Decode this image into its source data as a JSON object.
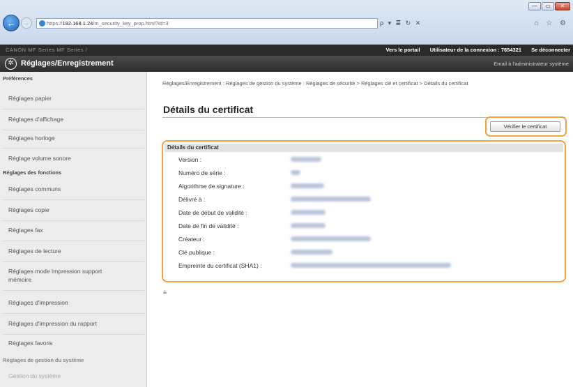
{
  "browser": {
    "url_prefix": "https://",
    "url_host": "192.168.1.24",
    "url_path": "/m_security_key_prop.html?id=3",
    "address_tools": "ρ ▾ ≣ ↻ ✕",
    "tab_icons": "⌂ ☆ ⚙",
    "window_buttons": [
      "—",
      "▭",
      "✕"
    ]
  },
  "topbar": {
    "device_name": "CANON   MF Series   MF Series /",
    "portal_link": "Vers le portail",
    "login_user_label": "Utilisateur de la connexion : 7654321",
    "logout_link": "Se déconnecter"
  },
  "header": {
    "title": "Réglages/Enregistrement",
    "mail_admin": "Email à l'administrateur système"
  },
  "sidebar": {
    "preferences": "Préférences",
    "pref_items": [
      "Réglages papier",
      "Réglages d'affichage",
      "Réglages horloge",
      "Réglage volume sonore"
    ],
    "functions": "Réglages des fonctions",
    "func_items": [
      "Réglages communs",
      "Réglages copie",
      "Réglages fax",
      "Réglages de lecture",
      "Réglages mode Impression support mémoire",
      "Réglages d'impression",
      "Réglages d'impression du rapport",
      "Réglages favoris"
    ],
    "sysmgmt": "Réglages de gestion du système",
    "sysmgmt_first": "Gestion du système"
  },
  "main": {
    "breadcrumb": "Réglages/Enregistrement : Réglages de gestion du système : Réglages de sécurité > Réglages clé et certificat > Détails du certificat",
    "page_title": "Détails du certificat",
    "verify_button": "Vérifier le certificat",
    "panel_title": "Détails du certificat",
    "rows": [
      {
        "label": "Version :"
      },
      {
        "label": "Numéro de série :"
      },
      {
        "label": "Algorithme de signature :"
      },
      {
        "label": "Délivré à :"
      },
      {
        "label": "Date de début de validité :"
      },
      {
        "label": "Date de fin de validité :"
      },
      {
        "label": "Créateur :"
      },
      {
        "label": "Clé publique :"
      },
      {
        "label": "Empreinte du certificat (SHA1) :"
      }
    ],
    "to_top_icon": "⩮"
  },
  "colors": {
    "highlight": "#f2a33a",
    "header_bg": "#2e2e2e",
    "sidebar_bg": "#ececec"
  }
}
